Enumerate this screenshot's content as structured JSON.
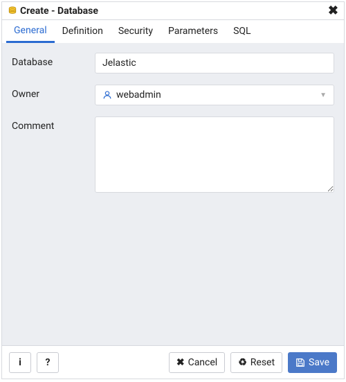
{
  "window": {
    "title": "Create - Database"
  },
  "tabs": [
    {
      "label": "General",
      "active": true
    },
    {
      "label": "Definition",
      "active": false
    },
    {
      "label": "Security",
      "active": false
    },
    {
      "label": "Parameters",
      "active": false
    },
    {
      "label": "SQL",
      "active": false
    }
  ],
  "form": {
    "database": {
      "label": "Database",
      "value": "Jelastic"
    },
    "owner": {
      "label": "Owner",
      "value": "webadmin",
      "icon": "user-icon"
    },
    "comment": {
      "label": "Comment",
      "value": ""
    }
  },
  "footer": {
    "info_icon": "i",
    "help_icon": "?",
    "cancel_label": "Cancel",
    "reset_label": "Reset",
    "save_label": "Save"
  }
}
